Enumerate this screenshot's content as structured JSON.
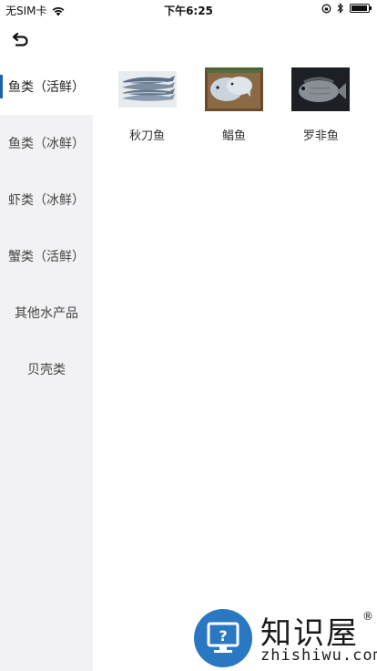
{
  "status_bar": {
    "carrier": "无SIM卡",
    "time": "下午6:25"
  },
  "categories": [
    {
      "label": "鱼类（活鲜）",
      "active": true
    },
    {
      "label": "鱼类（冰鲜）",
      "active": false
    },
    {
      "label": "虾类（冰鲜）",
      "active": false
    },
    {
      "label": "蟹类（活鲜）",
      "active": false
    },
    {
      "label": "其他水产品",
      "active": false
    },
    {
      "label": "贝壳类",
      "active": false
    }
  ],
  "products": [
    {
      "name": "秋刀鱼"
    },
    {
      "name": "鲳鱼"
    },
    {
      "name": "罗非鱼"
    }
  ],
  "watermark": {
    "logo_text": "知识屋",
    "reg": "®",
    "url": "zhishiwu.com"
  },
  "colors": {
    "accent": "#1f64a8",
    "sidebar_bg": "#f2f2f4"
  }
}
